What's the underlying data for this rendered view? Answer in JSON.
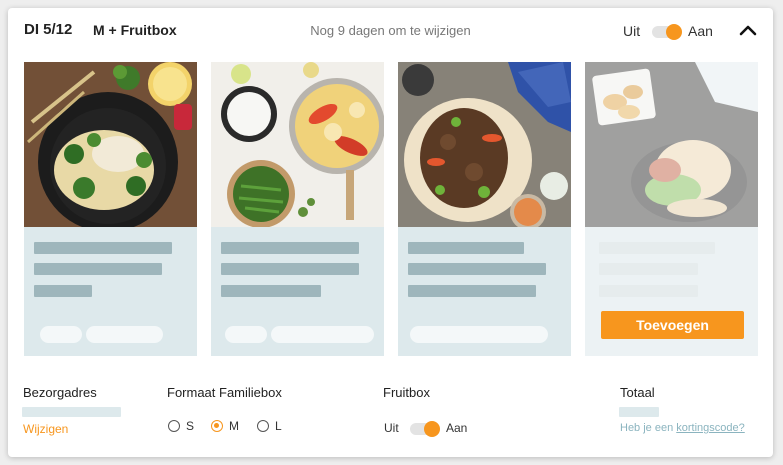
{
  "header": {
    "date": "DI 5/12",
    "box": "M + Fruitbox",
    "deadline": "Nog 9 dagen om te wijzigen",
    "toggle_off": "Uit",
    "toggle_on": "Aan",
    "toggle_state": "on",
    "collapse_icon": "chevron-up-icon"
  },
  "meals": [
    {
      "name": "meal-1",
      "photo": "pasta-chicken-broccoli",
      "selected": true
    },
    {
      "name": "meal-2",
      "photo": "chicken-curry-rice-beans",
      "selected": true
    },
    {
      "name": "meal-3",
      "photo": "wrap-minced-meat",
      "selected": true
    },
    {
      "name": "meal-4",
      "photo": "burger-potatoes",
      "selected": false,
      "button": "Toevoegen"
    }
  ],
  "footer": {
    "address": {
      "label": "Bezorgadres",
      "link": "Wijzigen"
    },
    "format": {
      "label": "Formaat Familiebox",
      "options": [
        "S",
        "M",
        "L"
      ],
      "selected": "M"
    },
    "fruitbox": {
      "label": "Fruitbox",
      "off": "Uit",
      "on": "Aan",
      "state": "on"
    },
    "total": {
      "label": "Totaal",
      "promo_prefix": "Heb je een",
      "promo_link": "kortingscode?"
    }
  },
  "colors": {
    "accent": "#f7961e",
    "placeholder_dark": "#9eb6bc",
    "placeholder_light": "#dde9ec",
    "promo": "#8bb4bf"
  }
}
